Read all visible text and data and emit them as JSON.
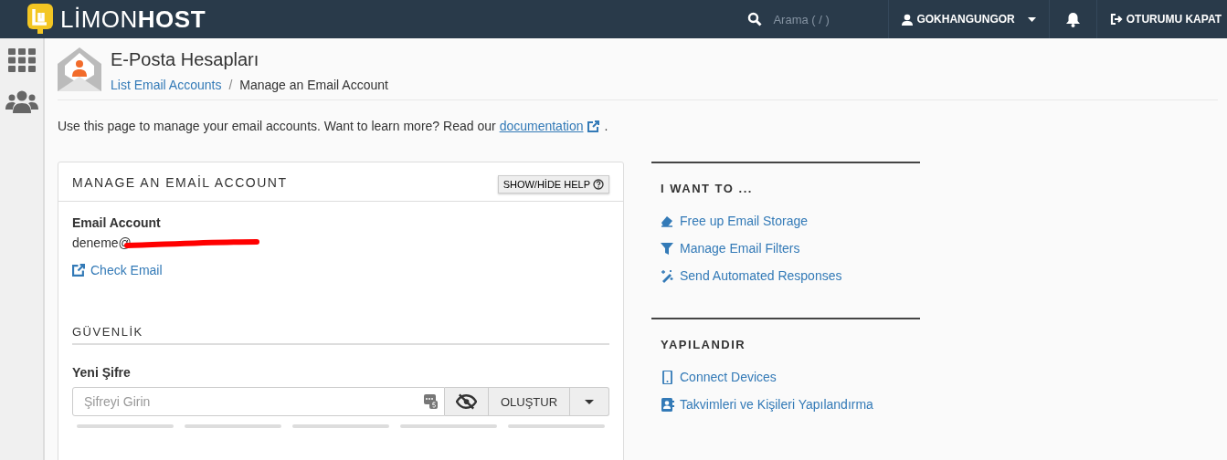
{
  "header": {
    "logo_light": "LİMON",
    "logo_bold": "HOST",
    "search": {
      "placeholder": "Arama ( / )"
    },
    "user": "GOKHANGUNGOR",
    "logout": "OTURUMU KAPAT"
  },
  "page": {
    "title": "E-Posta Hesapları",
    "breadcrumb": [
      {
        "label": "List Email Accounts",
        "kind": "link"
      },
      {
        "label": "/",
        "kind": "separator"
      },
      {
        "label": "Manage an Email Account",
        "kind": "current"
      }
    ],
    "intro": "Use this page to manage your email accounts. Want to learn more? Read our",
    "intro_link": "documentation",
    "intro_end": "."
  },
  "card": {
    "title": "MANAGE AN EMAİL ACCOUNT",
    "help_button": "SHOW/HİDE HELP",
    "account_label": "Email Account",
    "account_value": "deneme@",
    "check_email": "Check Email",
    "security": {
      "title": "GÜVENLİK",
      "password_label": "Yeni Şifre",
      "password": {
        "placeholder": "Şifreyi Girin"
      },
      "generate_button": "OLUŞTUR",
      "strength": {
        "level": 0
      }
    }
  },
  "sidebar_sections": [
    {
      "title": "I WANT TO ...",
      "links": [
        {
          "label": "Free up Email Storage",
          "kind": "eraser"
        },
        {
          "label": "Manage Email Filters",
          "kind": "filter"
        },
        {
          "label": "Send Automated Responses",
          "kind": "wand"
        }
      ]
    },
    {
      "title": "YAPILANDIR",
      "links": [
        {
          "label": "Connect Devices",
          "kind": "phone"
        },
        {
          "label": "Takvimleri ve Kişileri Yapılandırma",
          "kind": "contact"
        }
      ]
    }
  ]
}
